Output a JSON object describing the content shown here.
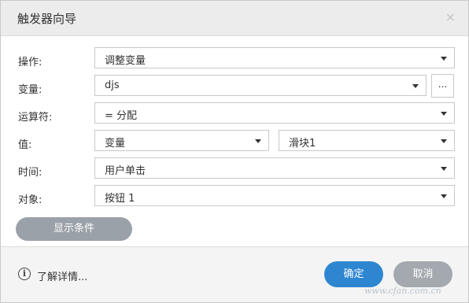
{
  "dialog": {
    "title": "触发器向导",
    "close_glyph": "×"
  },
  "fields": {
    "operation": {
      "label": "操作:",
      "value": "调整变量"
    },
    "variable": {
      "label": "变量:",
      "value": "djs",
      "more_label": "..."
    },
    "operator": {
      "label": "运算符:",
      "value": "= 分配"
    },
    "value": {
      "label": "值:",
      "type_value": "变量",
      "target_value": "滑块1"
    },
    "time": {
      "label": "时间:",
      "value": "用户单击"
    },
    "object": {
      "label": "对象:",
      "value": "按钮 1"
    }
  },
  "show_conditions_label": "显示条件",
  "footer": {
    "learn_more": "了解详情...",
    "info_glyph": "i",
    "ok_label": "确定",
    "cancel_label": "取消"
  },
  "watermark": "www.cfan.com.cn",
  "colors": {
    "primary": "#2e86d1",
    "secondary": "#a3a9ae",
    "titlebar": "#ececec"
  }
}
